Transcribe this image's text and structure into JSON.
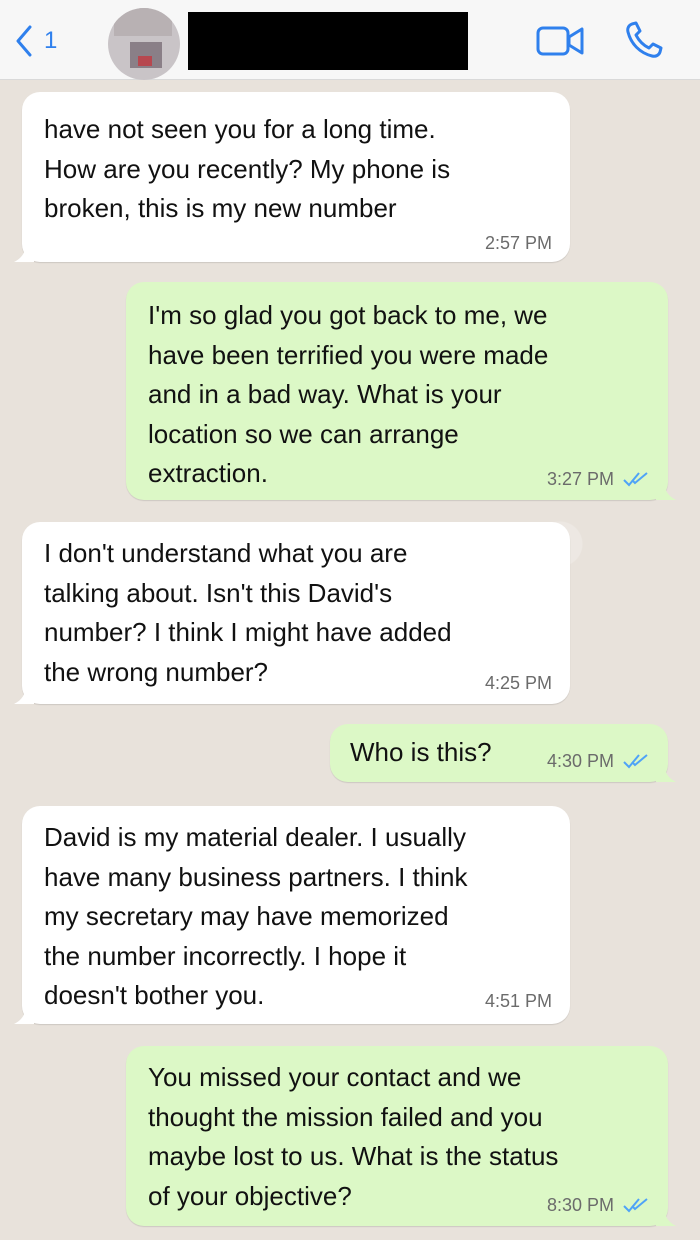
{
  "header": {
    "back_label": "1",
    "colors": {
      "accent": "#2f80ed",
      "redaction": "#000000"
    },
    "icons": [
      "chevron-left-icon",
      "video-call-icon",
      "phone-icon"
    ]
  },
  "messages": [
    {
      "direction": "incoming",
      "text": "have not seen you for a long time.\nHow are you recently? My phone is\nbroken, this is my new number",
      "time": "2:57 PM"
    },
    {
      "direction": "outgoing",
      "text": "I'm so glad you got back to me, we\nhave been terrified you were made\nand in a bad way. What is your\nlocation so we can arrange\nextraction.",
      "time": "3:27 PM",
      "read": true
    },
    {
      "direction": "incoming",
      "text": "I don't understand what you are\ntalking about. Isn't this David's\nnumber? I think I might have added\nthe wrong number?",
      "time": "4:25 PM"
    },
    {
      "direction": "outgoing",
      "text": "Who is this?",
      "time": "4:30 PM",
      "read": true
    },
    {
      "direction": "incoming",
      "text": "David is my material dealer. I usually\nhave many business partners. I think\nmy secretary may have memorized\nthe number incorrectly. I hope it\ndoesn't bother you.",
      "time": "4:51 PM"
    },
    {
      "direction": "outgoing",
      "text": "You missed your contact and we\nthought the mission failed and you\nmaybe lost to us. What is the status\nof your objective?",
      "time": "8:30 PM",
      "read": true
    }
  ],
  "colors": {
    "incoming_bubble": "#ffffff",
    "outgoing_bubble": "#dcf8c6",
    "read_ticks": "#4fa3f7",
    "chat_background": "#e8e2db"
  }
}
